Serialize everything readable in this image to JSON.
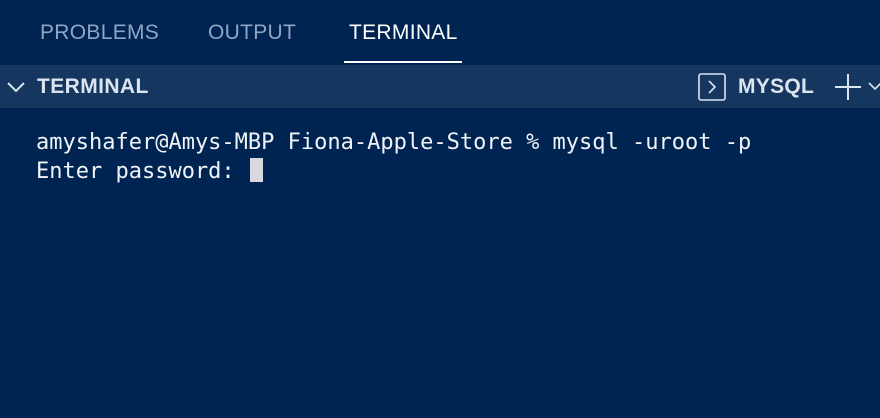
{
  "panel": {
    "tabs": [
      {
        "label": "PROBLEMS",
        "active": false
      },
      {
        "label": "OUTPUT",
        "active": false
      },
      {
        "label": "TERMINAL",
        "active": true
      }
    ]
  },
  "section": {
    "title": "TERMINAL",
    "profile": "MYSQL",
    "icons": [
      "chevron-down-icon",
      "terminal-icon",
      "plus-icon",
      "dropdown-icon"
    ]
  },
  "terminal": {
    "lines": [
      "amyshafer@Amys-MBP Fiona-Apple-Store % mysql -uroot -p",
      "Enter password: "
    ]
  },
  "colors": {
    "background": "#002451",
    "header_background": "#15365f",
    "inactive_tab": "#8ea5c6",
    "active_tab": "#ffffff",
    "text": "#f0f3f7"
  }
}
